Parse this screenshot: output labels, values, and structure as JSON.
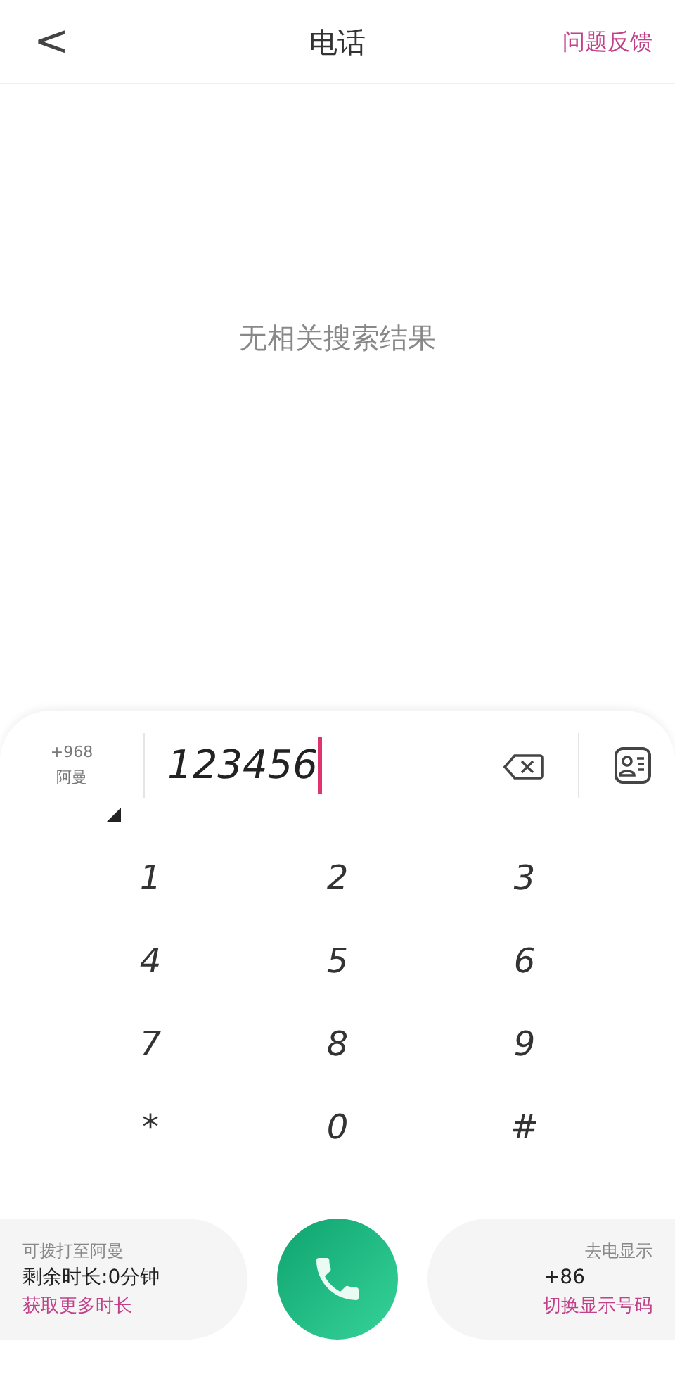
{
  "header": {
    "back": "<",
    "title": "电话",
    "feedback": "问题反馈"
  },
  "empty_message": "无相关搜索结果",
  "dialer": {
    "country_code": "+968",
    "country_name": "阿曼",
    "number": "123456"
  },
  "keys": [
    "1",
    "2",
    "3",
    "4",
    "5",
    "6",
    "7",
    "8",
    "9",
    "*",
    "0",
    "#"
  ],
  "minutes_card": {
    "destination": "可拨打至阿曼",
    "remaining": "剩余时长:0分钟",
    "link": "获取更多时长"
  },
  "caller_id_card": {
    "title": "去电显示",
    "number": "+86",
    "link": "切换显示号码"
  }
}
